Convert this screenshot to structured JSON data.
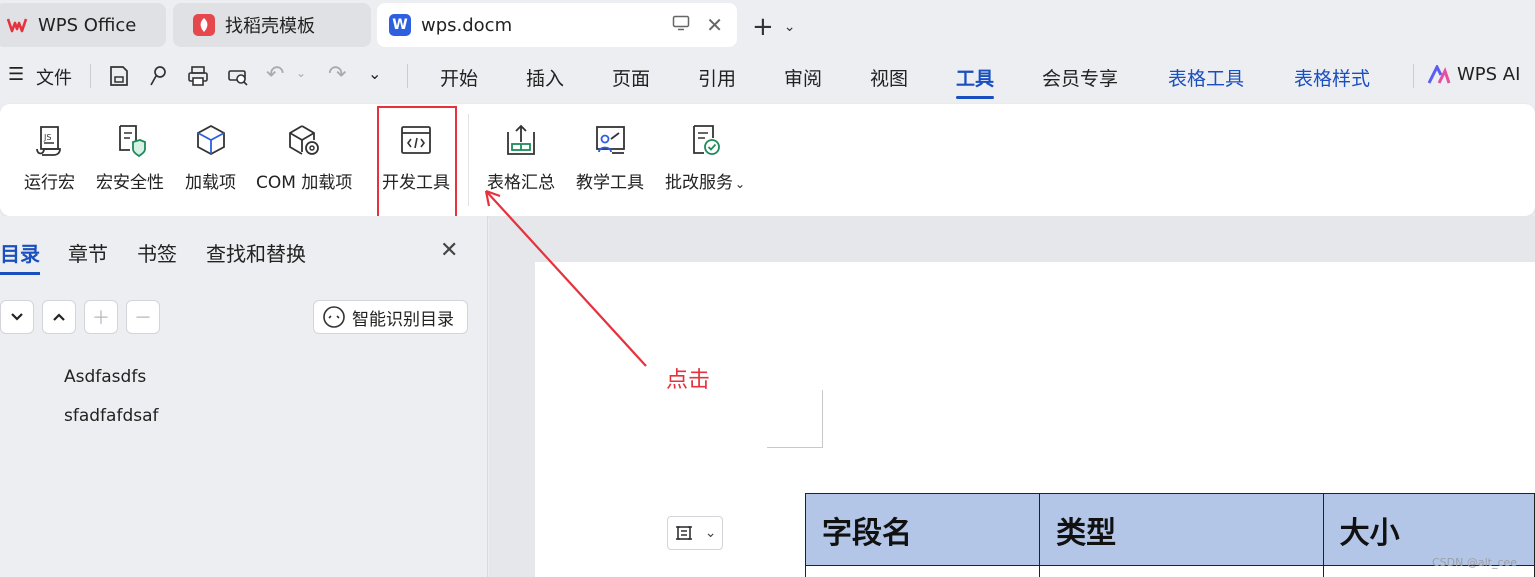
{
  "tabs": [
    {
      "label": "WPS Office"
    },
    {
      "label": "找稻壳模板"
    },
    {
      "label": "wps.docm"
    }
  ],
  "menu": {
    "file_label": "文件",
    "tabs": [
      "开始",
      "插入",
      "页面",
      "引用",
      "审阅",
      "视图",
      "工具",
      "会员专享",
      "表格工具",
      "表格样式"
    ],
    "ai_label": "WPS AI"
  },
  "ribbon": {
    "buttons": [
      "运行宏",
      "宏安全性",
      "加载项",
      "COM 加载项",
      "开发工具",
      "表格汇总",
      "教学工具",
      "批改服务"
    ]
  },
  "left_pane": {
    "tabs": [
      "目录",
      "章节",
      "书签",
      "查找和替换"
    ],
    "smart_toc_label": "智能识别目录",
    "toc_items": [
      "Asdfasdfs",
      "sfadfafdsaf"
    ]
  },
  "document": {
    "table_headers": [
      "字段名",
      "类型",
      "大小"
    ]
  },
  "annotation": {
    "text": "点击",
    "color": "#e5323d"
  },
  "watermark": "CSDN @alt_cee",
  "colors": {
    "accent": "#1a4fbf",
    "table_header": "#b4c6e7"
  }
}
